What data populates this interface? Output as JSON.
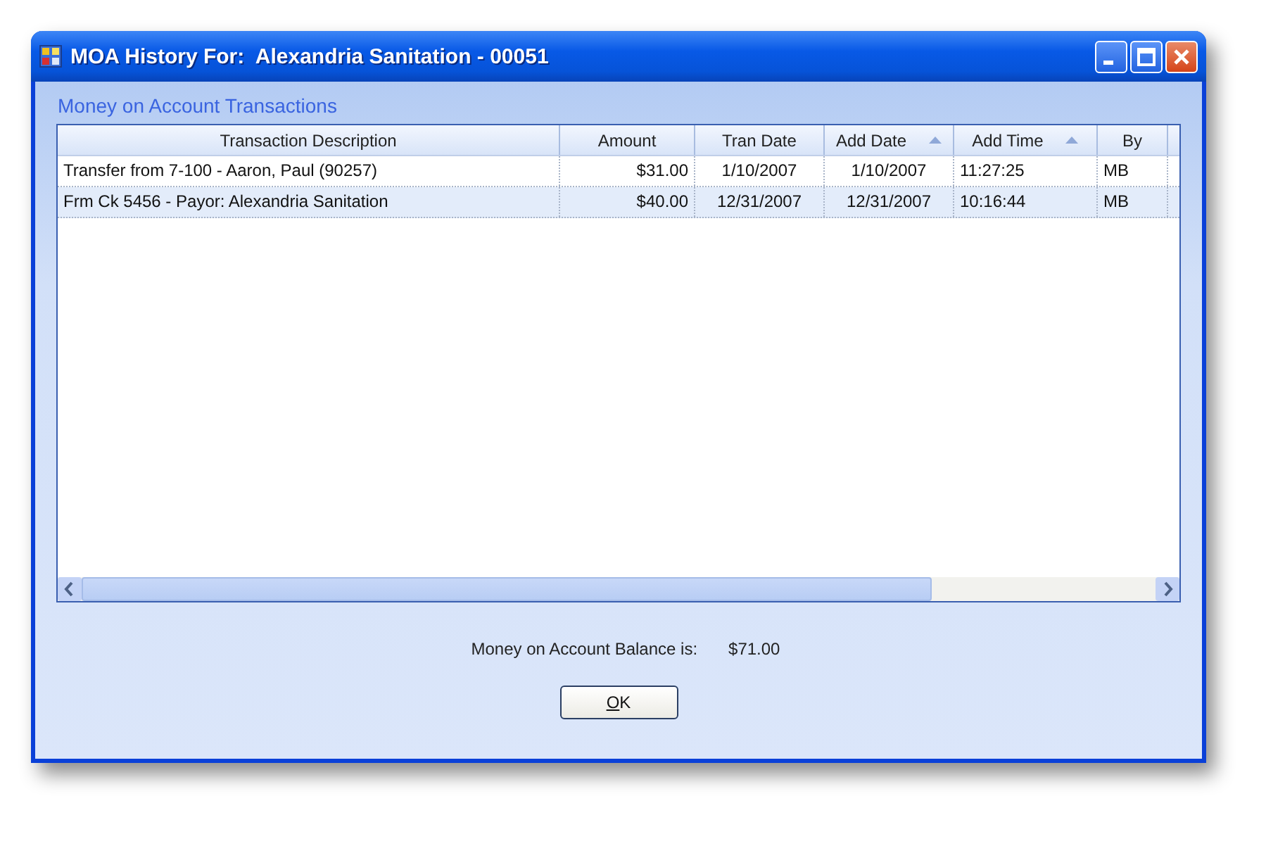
{
  "window": {
    "title": "MOA History For:  Alexandria Sanitation - 00051"
  },
  "group_title": "Money on Account Transactions",
  "table": {
    "columns": [
      {
        "label": "Transaction Description",
        "sorted": false
      },
      {
        "label": "Amount",
        "sorted": false
      },
      {
        "label": "Tran Date",
        "sorted": false
      },
      {
        "label": "Add Date",
        "sorted": true
      },
      {
        "label": "Add Time",
        "sorted": true
      },
      {
        "label": "By",
        "sorted": false
      }
    ],
    "rows": [
      {
        "cells": [
          "Transfer from 7-100 - Aaron, Paul (90257)",
          "$31.00",
          "1/10/2007",
          "1/10/2007",
          "11:27:25",
          "MB"
        ],
        "selected": false
      },
      {
        "cells": [
          "Frm Ck 5456 - Payor: Alexandria Sanitation",
          "$40.00",
          "12/31/2007",
          "12/31/2007",
          "10:16:44",
          "MB"
        ],
        "selected": true
      }
    ]
  },
  "balance": {
    "label": "Money on Account Balance is:",
    "value": "$71.00"
  },
  "buttons": [
    "OK"
  ]
}
